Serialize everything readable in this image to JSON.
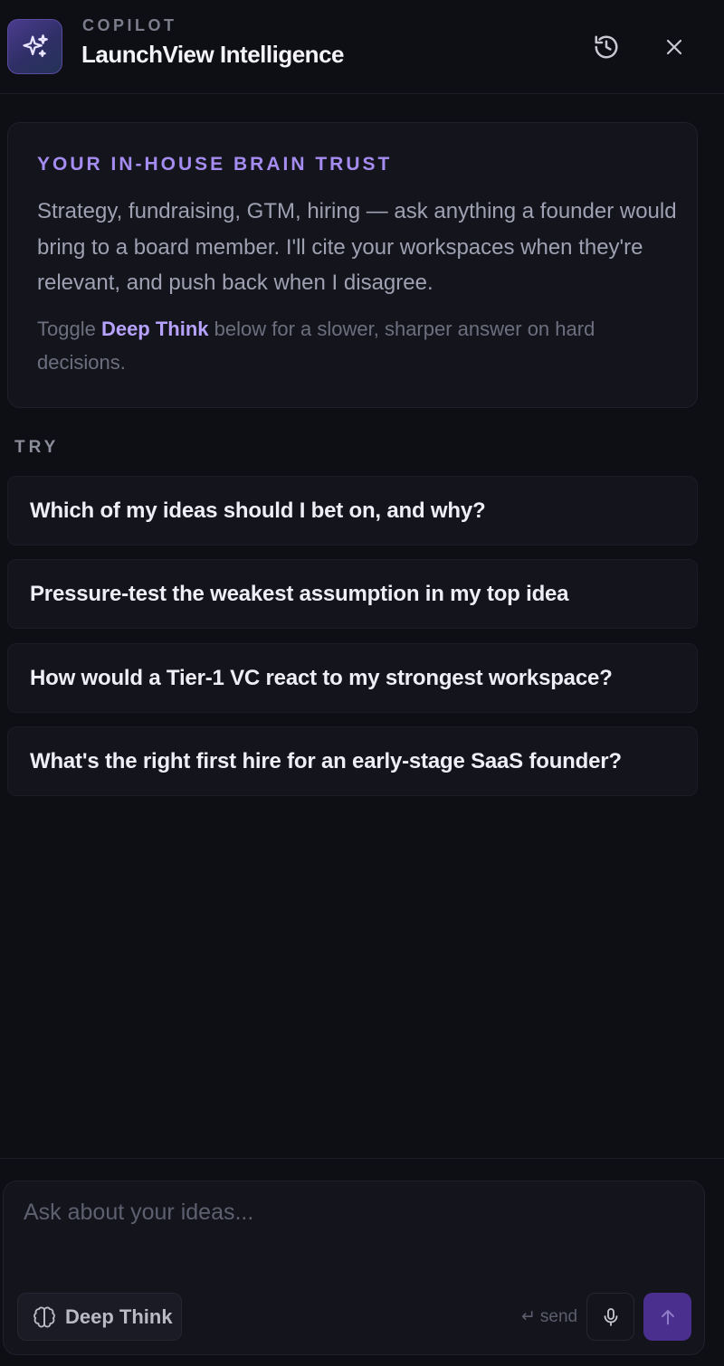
{
  "header": {
    "eyebrow": "COPILOT",
    "title": "LaunchView Intelligence",
    "icons": {
      "app": "sparkles-icon",
      "history": "history-icon",
      "close": "close-icon"
    }
  },
  "intro": {
    "eyebrow": "YOUR IN-HOUSE BRAIN TRUST",
    "body": "Strategy, fundraising, GTM, hiring — ask anything a founder would bring to a board member. I'll cite your workspaces when they're relevant, and push back when I disagree.",
    "note_prefix": "Toggle ",
    "note_highlight": "Deep Think",
    "note_suffix": " below for a slower, sharper answer on hard decisions."
  },
  "suggestions": {
    "label": "TRY",
    "items": [
      "Which of my ideas should I bet on, and why?",
      "Pressure-test the weakest assumption in my top idea",
      "How would a Tier-1 VC react to my strongest workspace?",
      "What's the right first hire for an early-stage SaaS founder?"
    ]
  },
  "composer": {
    "placeholder": "Ask about your ideas...",
    "value": "",
    "deep_think_label": "Deep Think",
    "send_hint_symbol": "↵",
    "send_hint": "send",
    "icons": {
      "deep_think": "brain-icon",
      "mic": "microphone-icon",
      "send": "arrow-up-icon"
    }
  },
  "colors": {
    "background": "#0e0f14",
    "card": "#13141c",
    "accent": "#a48cf0",
    "accent_highlight": "#b7a3ff",
    "send_button": "#4a2f8e"
  }
}
